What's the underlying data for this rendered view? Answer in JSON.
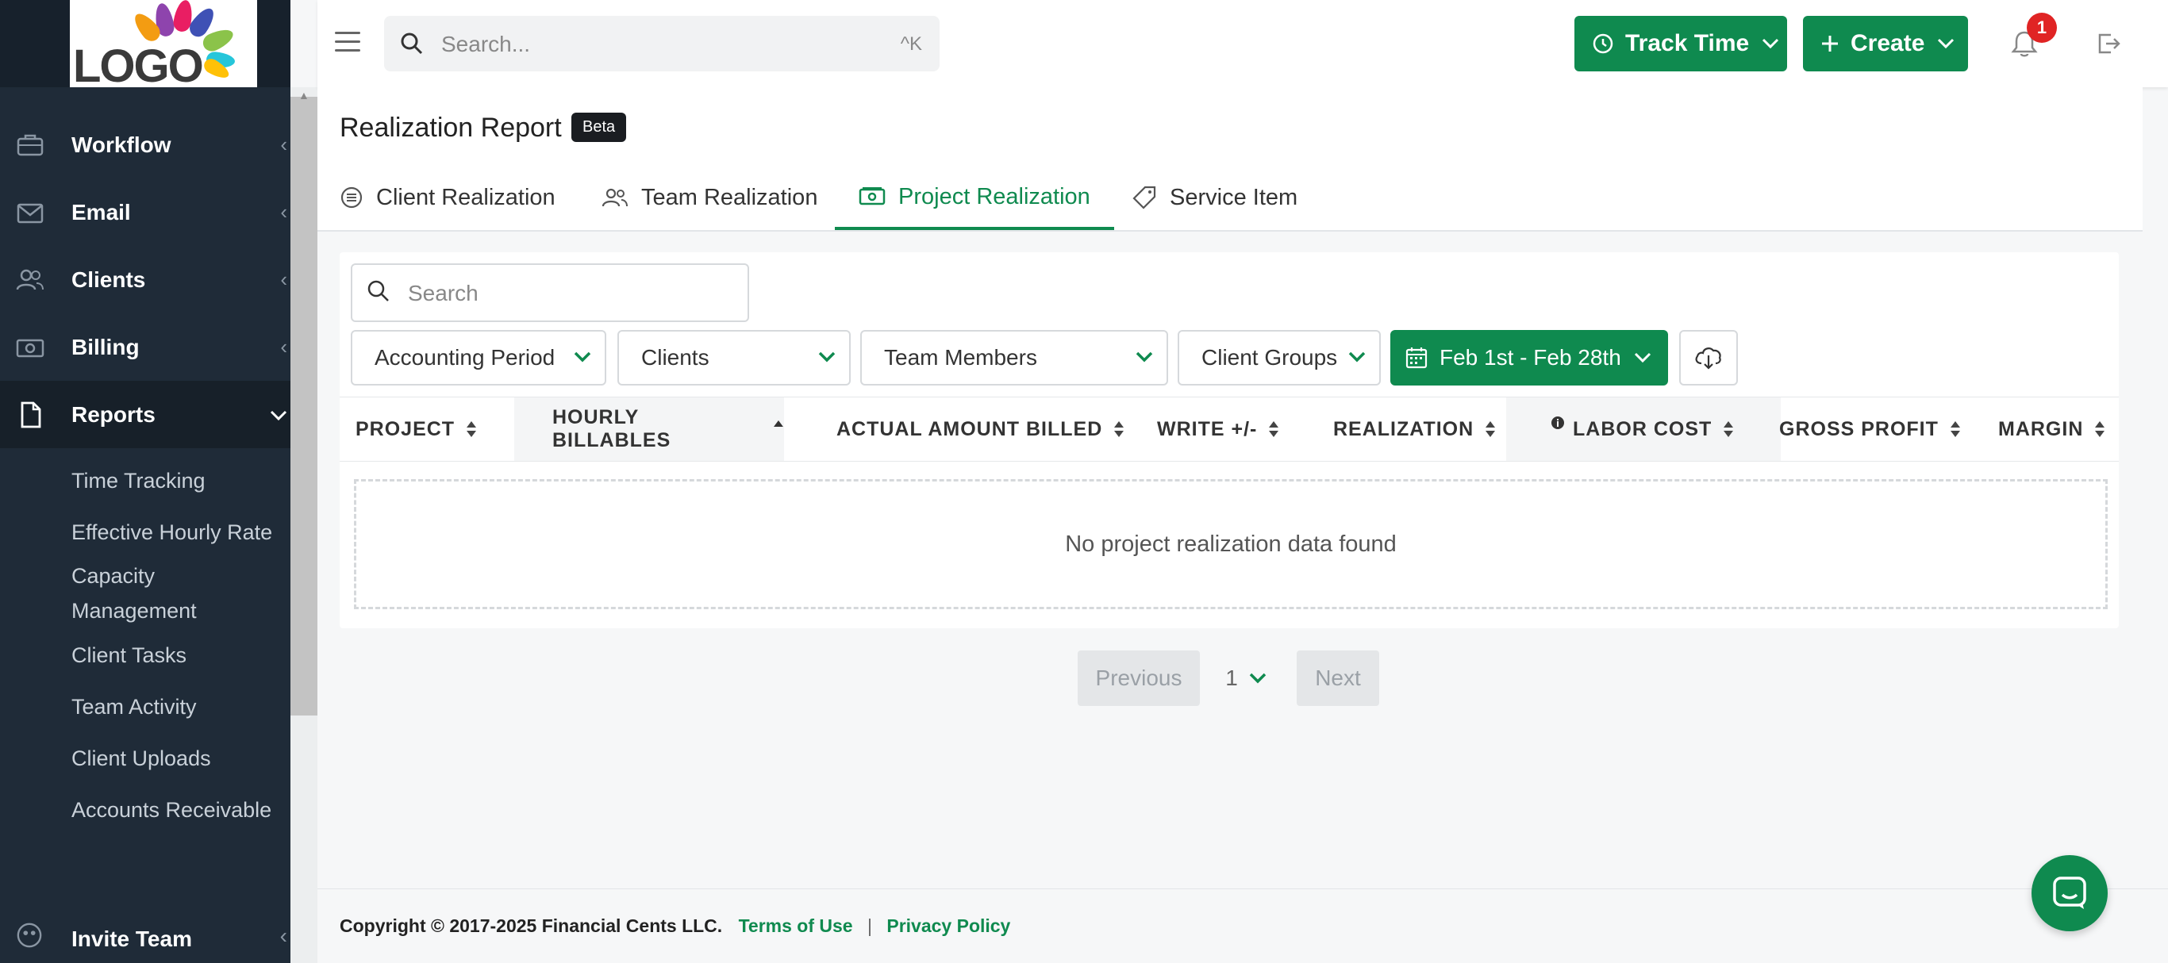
{
  "logo": {
    "text": "LOGO"
  },
  "sidebar": {
    "items": [
      {
        "label": "Workflow",
        "icon": "briefcase-icon"
      },
      {
        "label": "Email",
        "icon": "envelope-icon"
      },
      {
        "label": "Clients",
        "icon": "users-icon"
      },
      {
        "label": "Billing",
        "icon": "money-icon"
      },
      {
        "label": "Reports",
        "icon": "document-icon"
      }
    ],
    "reports_sub": [
      "Time Tracking",
      "Effective Hourly Rate",
      "Capacity Management",
      "Client Tasks",
      "Team Activity",
      "Client Uploads",
      "Accounts Receivable"
    ],
    "invite": "Invite Team"
  },
  "topbar": {
    "search_placeholder": "Search...",
    "search_shortcut": "^K",
    "track_time": "Track Time",
    "create": "Create",
    "notification_count": "1"
  },
  "page": {
    "title": "Realization Report",
    "beta": "Beta",
    "tabs": [
      "Client Realization",
      "Team Realization",
      "Project Realization",
      "Service Item"
    ]
  },
  "table": {
    "search_placeholder": "Search",
    "filters": [
      "Accounting Period",
      "Clients",
      "Team Members",
      "Client Groups"
    ],
    "date_range": "Feb 1st - Feb 28th",
    "columns": [
      "PROJECT",
      "HOURLY BILLABLES",
      "ACTUAL AMOUNT BILLED",
      "WRITE +/-",
      "REALIZATION",
      "LABOR COST",
      "GROSS PROFIT",
      "MARGIN"
    ],
    "empty_message": "No project realization data found"
  },
  "pagination": {
    "previous": "Previous",
    "page": "1",
    "next": "Next"
  },
  "footer": {
    "copyright": "Copyright © 2017-2025 Financial Cents LLC.",
    "terms": "Terms of Use",
    "separator": "|",
    "privacy": "Privacy Policy"
  },
  "colors": {
    "brand_green": "#0f8a4f",
    "sidebar_bg": "#1f2b38",
    "badge_red": "#e02424"
  }
}
